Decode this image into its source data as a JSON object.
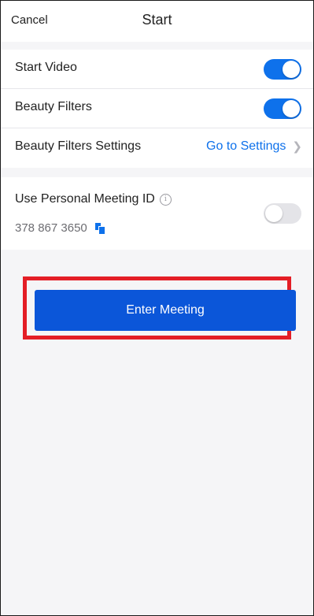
{
  "header": {
    "cancel_label": "Cancel",
    "title": "Start"
  },
  "settings": {
    "start_video": {
      "label": "Start Video",
      "enabled": true
    },
    "beauty_filters": {
      "label": "Beauty Filters",
      "enabled": true
    },
    "beauty_filters_settings": {
      "label": "Beauty Filters Settings",
      "link": "Go to Settings"
    }
  },
  "personal_meeting": {
    "label": "Use Personal Meeting ID",
    "meeting_id": "378 867 3650",
    "enabled": false
  },
  "actions": {
    "enter_meeting": "Enter Meeting"
  },
  "icons": {
    "info": "info-icon",
    "copy": "copy-icon",
    "chevron": "chevron-right-icon"
  },
  "colors": {
    "accent": "#0e71eb",
    "button": "#0b56d9",
    "highlight": "#e41e26"
  }
}
